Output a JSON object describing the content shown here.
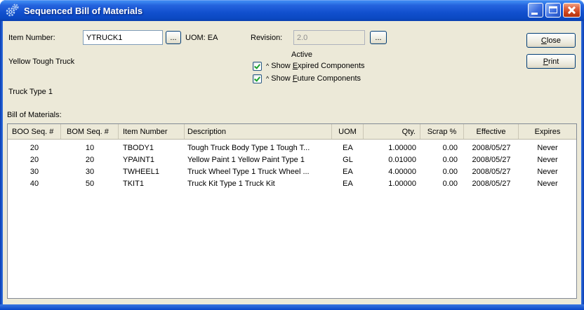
{
  "window": {
    "title": "Sequenced Bill of Materials"
  },
  "titlebar": {
    "icon": "gears-icon",
    "buttons": [
      "minimize",
      "maximize",
      "close"
    ]
  },
  "form": {
    "item_number": {
      "label": "Item Number:",
      "value": "YTRUCK1",
      "browse": "..."
    },
    "uom": {
      "label": "UOM:",
      "value": "EA"
    },
    "revision": {
      "label": "Revision:",
      "value": "2.0",
      "browse": "...",
      "disabled": true
    },
    "item_desc_line1": "Yellow Tough Truck",
    "item_desc_line2": "Truck Type 1",
    "active_label": "Active",
    "checkboxes": [
      {
        "caret": "^",
        "pre": "Show ",
        "key": "E",
        "rest": "xpired Components",
        "checked": true
      },
      {
        "caret": "^",
        "pre": "Show ",
        "key": "F",
        "rest": "uture Components",
        "checked": true
      }
    ]
  },
  "buttons": {
    "close": {
      "key": "C",
      "rest": "lose"
    },
    "print": {
      "key": "P",
      "rest": "rint"
    }
  },
  "table": {
    "caption": "Bill of Materials:",
    "columns": [
      {
        "key": "boo",
        "label": "BOO Seq. #"
      },
      {
        "key": "bom",
        "label": "BOM Seq. #"
      },
      {
        "key": "item",
        "label": "Item Number"
      },
      {
        "key": "desc",
        "label": "Description"
      },
      {
        "key": "uom",
        "label": "UOM"
      },
      {
        "key": "qty",
        "label": "Qty."
      },
      {
        "key": "scrap",
        "label": "Scrap %"
      },
      {
        "key": "effective",
        "label": "Effective"
      },
      {
        "key": "expires",
        "label": "Expires"
      }
    ],
    "rows": [
      {
        "boo": "20",
        "bom": "10",
        "item": "TBODY1",
        "desc": "Tough Truck Body Type 1 Tough T...",
        "uom": "EA",
        "qty": "1.00000",
        "scrap": "0.00",
        "effective": "2008/05/27",
        "expires": "Never"
      },
      {
        "boo": "20",
        "bom": "20",
        "item": "YPAINT1",
        "desc": "Yellow Paint 1  Yellow Paint Type 1",
        "uom": "GL",
        "qty": "0.01000",
        "scrap": "0.00",
        "effective": "2008/05/27",
        "expires": "Never"
      },
      {
        "boo": "30",
        "bom": "30",
        "item": "TWHEEL1",
        "desc": "Truck Wheel Type 1 Truck Wheel ...",
        "uom": "EA",
        "qty": "4.00000",
        "scrap": "0.00",
        "effective": "2008/05/27",
        "expires": "Never"
      },
      {
        "boo": "40",
        "bom": "50",
        "item": "TKIT1",
        "desc": "Truck Kit Type 1 Truck Kit",
        "uom": "EA",
        "qty": "1.00000",
        "scrap": "0.00",
        "effective": "2008/05/27",
        "expires": "Never"
      }
    ]
  },
  "colors": {
    "titlebar_blue": "#1150CE",
    "dialog_beige": "#ECE9D8",
    "close_red": "#CC4218",
    "check_green": "#18A12B"
  }
}
